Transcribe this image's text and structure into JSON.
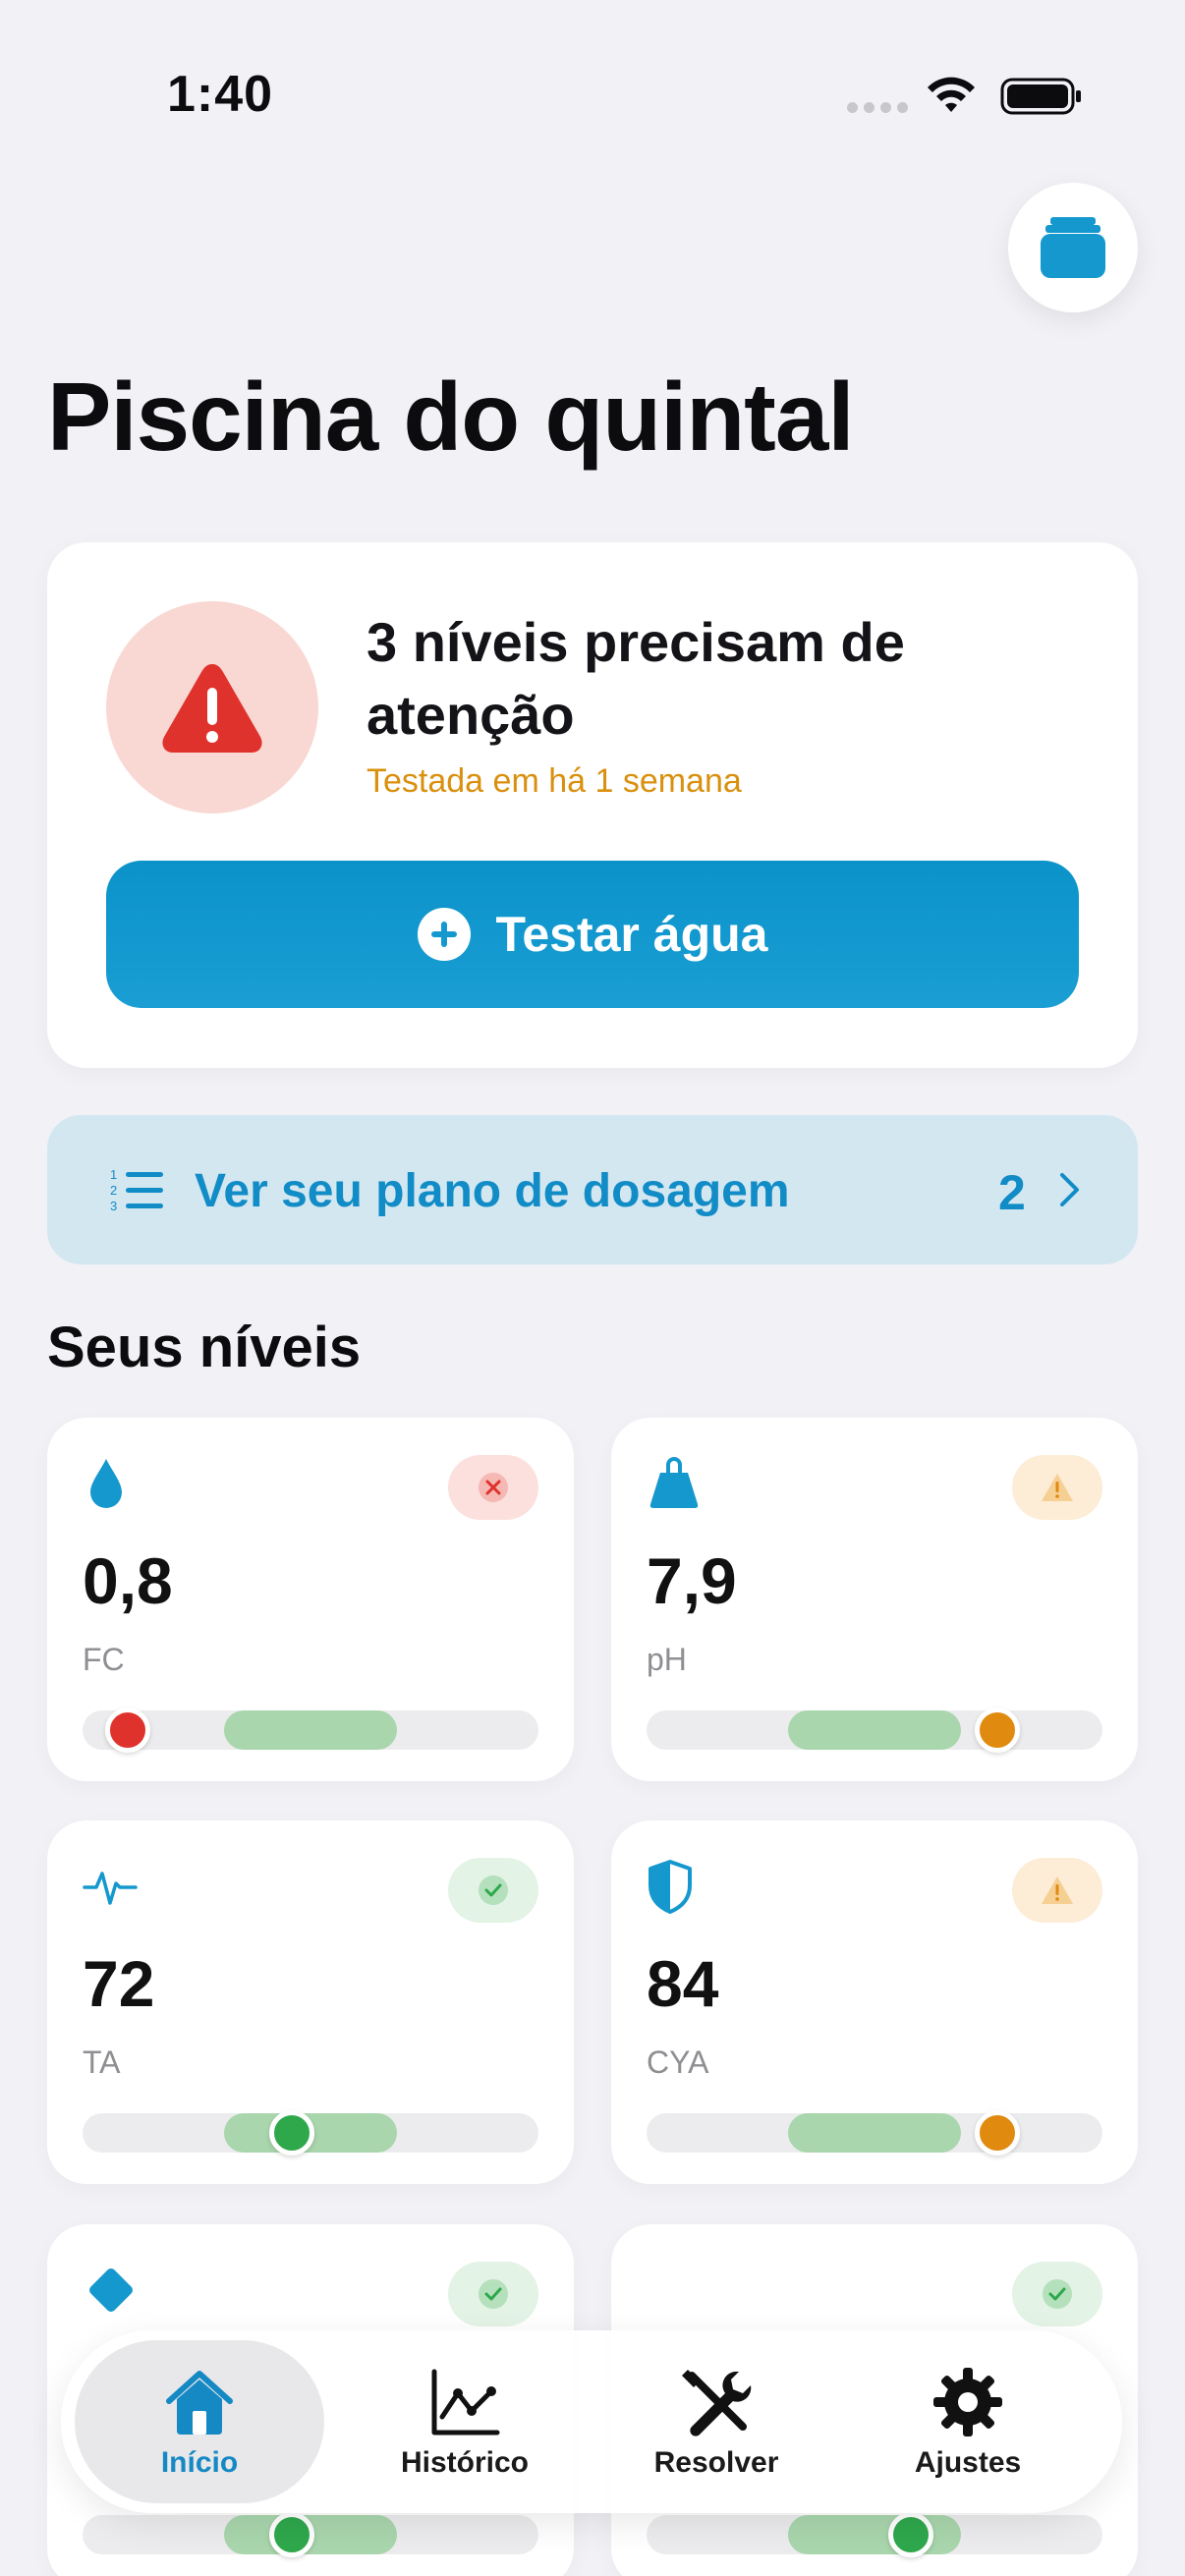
{
  "status_bar": {
    "time": "1:40"
  },
  "header": {
    "title": "Piscina do quintal",
    "pools_button_icon": "stack-icon"
  },
  "alert": {
    "title": "3 níveis precisam de atenção",
    "subtitle": "Testada em há 1 semana",
    "button_label": "Testar água",
    "icon": "warning-triangle-icon"
  },
  "dosage": {
    "label": "Ver seu plano de dosagem",
    "count": "2",
    "icon": "numbered-list-icon"
  },
  "levels_section": {
    "title": "Seus níveis"
  },
  "levels": [
    {
      "value": "0,8",
      "label": "FC",
      "icon": "drop-icon",
      "status": "error",
      "range_start": 0.31,
      "range_end": 0.69,
      "marker": 0.1
    },
    {
      "value": "7,9",
      "label": "pH",
      "icon": "kettlebell-icon",
      "status": "warning",
      "range_start": 0.31,
      "range_end": 0.69,
      "marker": 0.77
    },
    {
      "value": "72",
      "label": "TA",
      "icon": "pulse-icon",
      "status": "ok",
      "range_start": 0.31,
      "range_end": 0.69,
      "marker": 0.46
    },
    {
      "value": "84",
      "label": "CYA",
      "icon": "shield-icon",
      "status": "warning",
      "range_start": 0.31,
      "range_end": 0.69,
      "marker": 0.77
    }
  ],
  "colors": {
    "accent": "#1598ce",
    "error": "#e0322c",
    "warning": "#e08a0f",
    "ok": "#2fa84c",
    "range": "#a9d6ad"
  },
  "tabs": [
    {
      "label": "Início",
      "icon": "house-icon",
      "active": true
    },
    {
      "label": "Histórico",
      "icon": "chart-line-icon",
      "active": false
    },
    {
      "label": "Resolver",
      "icon": "tools-icon",
      "active": false
    },
    {
      "label": "Ajustes",
      "icon": "gear-icon",
      "active": false
    }
  ]
}
